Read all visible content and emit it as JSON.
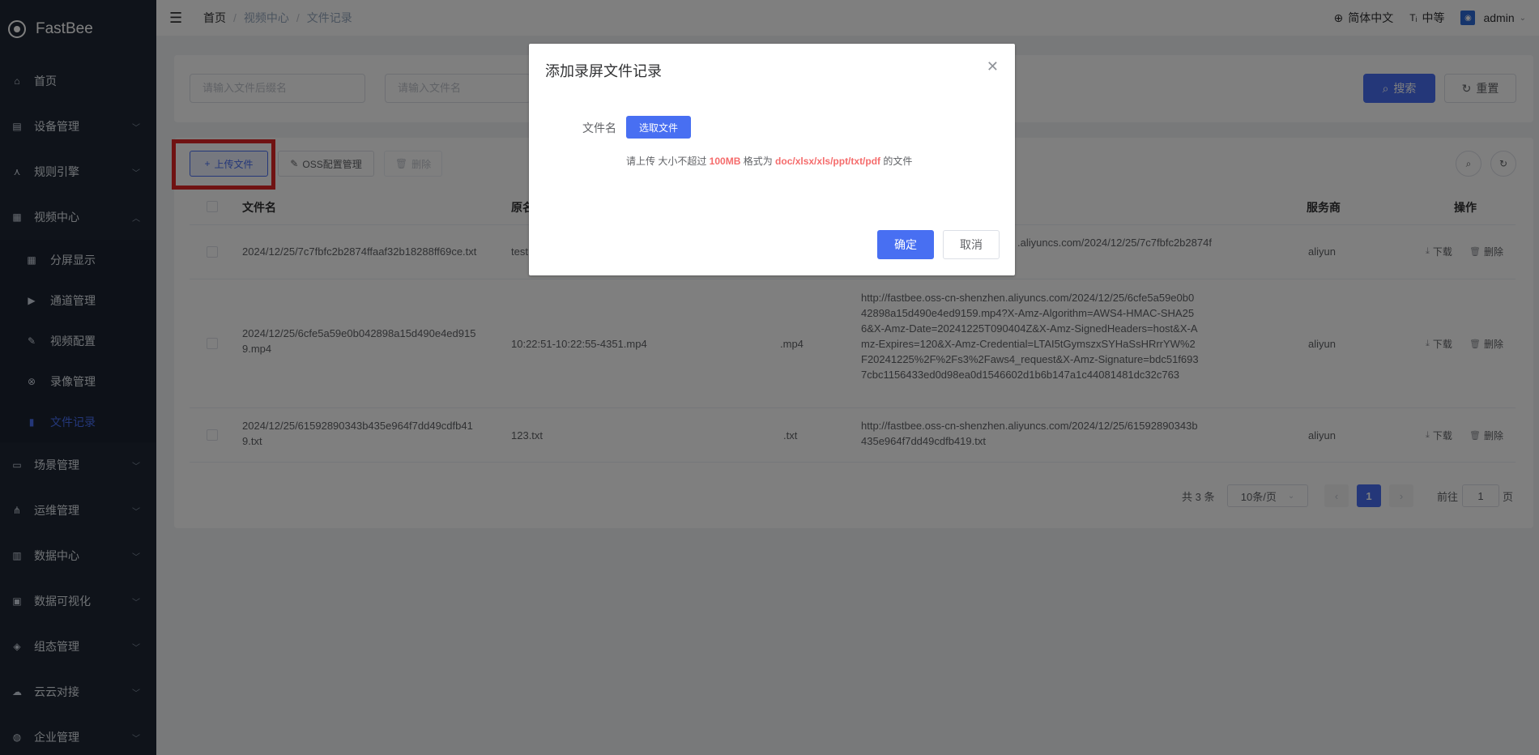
{
  "app": {
    "name": "FastBee"
  },
  "sidebar": {
    "items": [
      {
        "label": "首页",
        "icon": "home-icon",
        "glyph": "⌂"
      },
      {
        "label": "设备管理",
        "icon": "device-icon",
        "glyph": "▤"
      },
      {
        "label": "规则引擎",
        "icon": "rule-icon",
        "glyph": "⋏"
      },
      {
        "label": "视频中心",
        "icon": "video-icon",
        "glyph": "▦"
      },
      {
        "label": "场景管理",
        "icon": "scene-icon",
        "glyph": "▭"
      },
      {
        "label": "运维管理",
        "icon": "ops-icon",
        "glyph": "⋔"
      },
      {
        "label": "数据中心",
        "icon": "data-icon",
        "glyph": "▥"
      },
      {
        "label": "数据可视化",
        "icon": "visual-icon",
        "glyph": "▣"
      },
      {
        "label": "组态管理",
        "icon": "layers-icon",
        "glyph": "◈"
      },
      {
        "label": "云云对接",
        "icon": "cloud-icon",
        "glyph": "☁"
      },
      {
        "label": "企业管理",
        "icon": "enterprise-icon",
        "glyph": "◍"
      }
    ],
    "video_sub": [
      {
        "label": "分屏显示",
        "icon": "grid-icon",
        "glyph": "▦"
      },
      {
        "label": "通道管理",
        "icon": "channel-icon",
        "glyph": "▶"
      },
      {
        "label": "视频配置",
        "icon": "edit-icon",
        "glyph": "✎"
      },
      {
        "label": "录像管理",
        "icon": "record-icon",
        "glyph": "⊗"
      },
      {
        "label": "文件记录",
        "icon": "file-icon",
        "glyph": "▮"
      }
    ]
  },
  "topbar": {
    "breadcrumb": [
      "首页",
      "视频中心",
      "文件记录"
    ],
    "language": "简体中文",
    "font_size": "中等",
    "user": "admin"
  },
  "search": {
    "suffix_placeholder": "请输入文件后缀名",
    "name_placeholder": "请输入文件名",
    "search_label": "搜索",
    "reset_label": "重置"
  },
  "toolbar": {
    "upload_label": "上传文件",
    "oss_label": "OSS配置管理",
    "delete_label": "删除"
  },
  "table": {
    "headers": {
      "filename": "文件名",
      "original": "原名",
      "provider": "服务商",
      "actions": "操作"
    },
    "rows": [
      {
        "filename": [
          "2024/12/25/7c7fbfc2b2874ffaaf32b18288ff69ce.txt"
        ],
        "original": "test",
        "suffix": "",
        "url": [
          ".aliyuncs.com/2024/12/25/7c7fbfc2b2874f"
        ],
        "provider": "aliyun"
      },
      {
        "filename": [
          "2024/12/25/6cfe5a59e0b042898a15d490e4ed915",
          "9.mp4"
        ],
        "original": "10:22:51-10:22:55-4351.mp4",
        "suffix": ".mp4",
        "url": [
          "http://fastbee.oss-cn-shenzhen.aliyuncs.com/2024/12/25/6cfe5a59e0b0",
          "42898a15d490e4ed9159.mp4?X-Amz-Algorithm=AWS4-HMAC-SHA25",
          "6&X-Amz-Date=20241225T090404Z&X-Amz-SignedHeaders=host&X-A",
          "mz-Expires=120&X-Amz-Credential=LTAI5tGymszxSYHaSsHRrrYW%2",
          "F20241225%2F%2Fs3%2Faws4_request&X-Amz-Signature=bdc51f693",
          "7cbc1156433ed0d98ea0d1546602d1b6b147a1c44081481dc32c763"
        ],
        "provider": "aliyun"
      },
      {
        "filename": [
          "2024/12/25/61592890343b435e964f7dd49cdfb41",
          "9.txt"
        ],
        "original": "123.txt",
        "suffix": ".txt",
        "url": [
          "http://fastbee.oss-cn-shenzhen.aliyuncs.com/2024/12/25/61592890343b",
          "435e964f7dd49cdfb419.txt"
        ],
        "provider": "aliyun"
      }
    ],
    "download_label": "下载",
    "delete_label": "删除"
  },
  "pagination": {
    "total_text": "共 3 条",
    "page_size": "10条/页",
    "current_page": "1",
    "goto_label": "前往",
    "goto_value": "1",
    "page_unit": "页"
  },
  "dialog": {
    "title": "添加录屏文件记录",
    "file_label": "文件名",
    "select_button": "选取文件",
    "tip_prefix": "请上传 大小不超过 ",
    "tip_size": "100MB",
    "tip_mid": " 格式为 ",
    "tip_formats": "doc/xlsx/xls/ppt/txt/pdf",
    "tip_suffix": " 的文件",
    "confirm_label": "确定",
    "cancel_label": "取消"
  },
  "colors": {
    "accent": "#486ff2",
    "sidebar_bg": "#1e2735",
    "danger_text": "#f56c6c",
    "highlight": "#e02424"
  }
}
